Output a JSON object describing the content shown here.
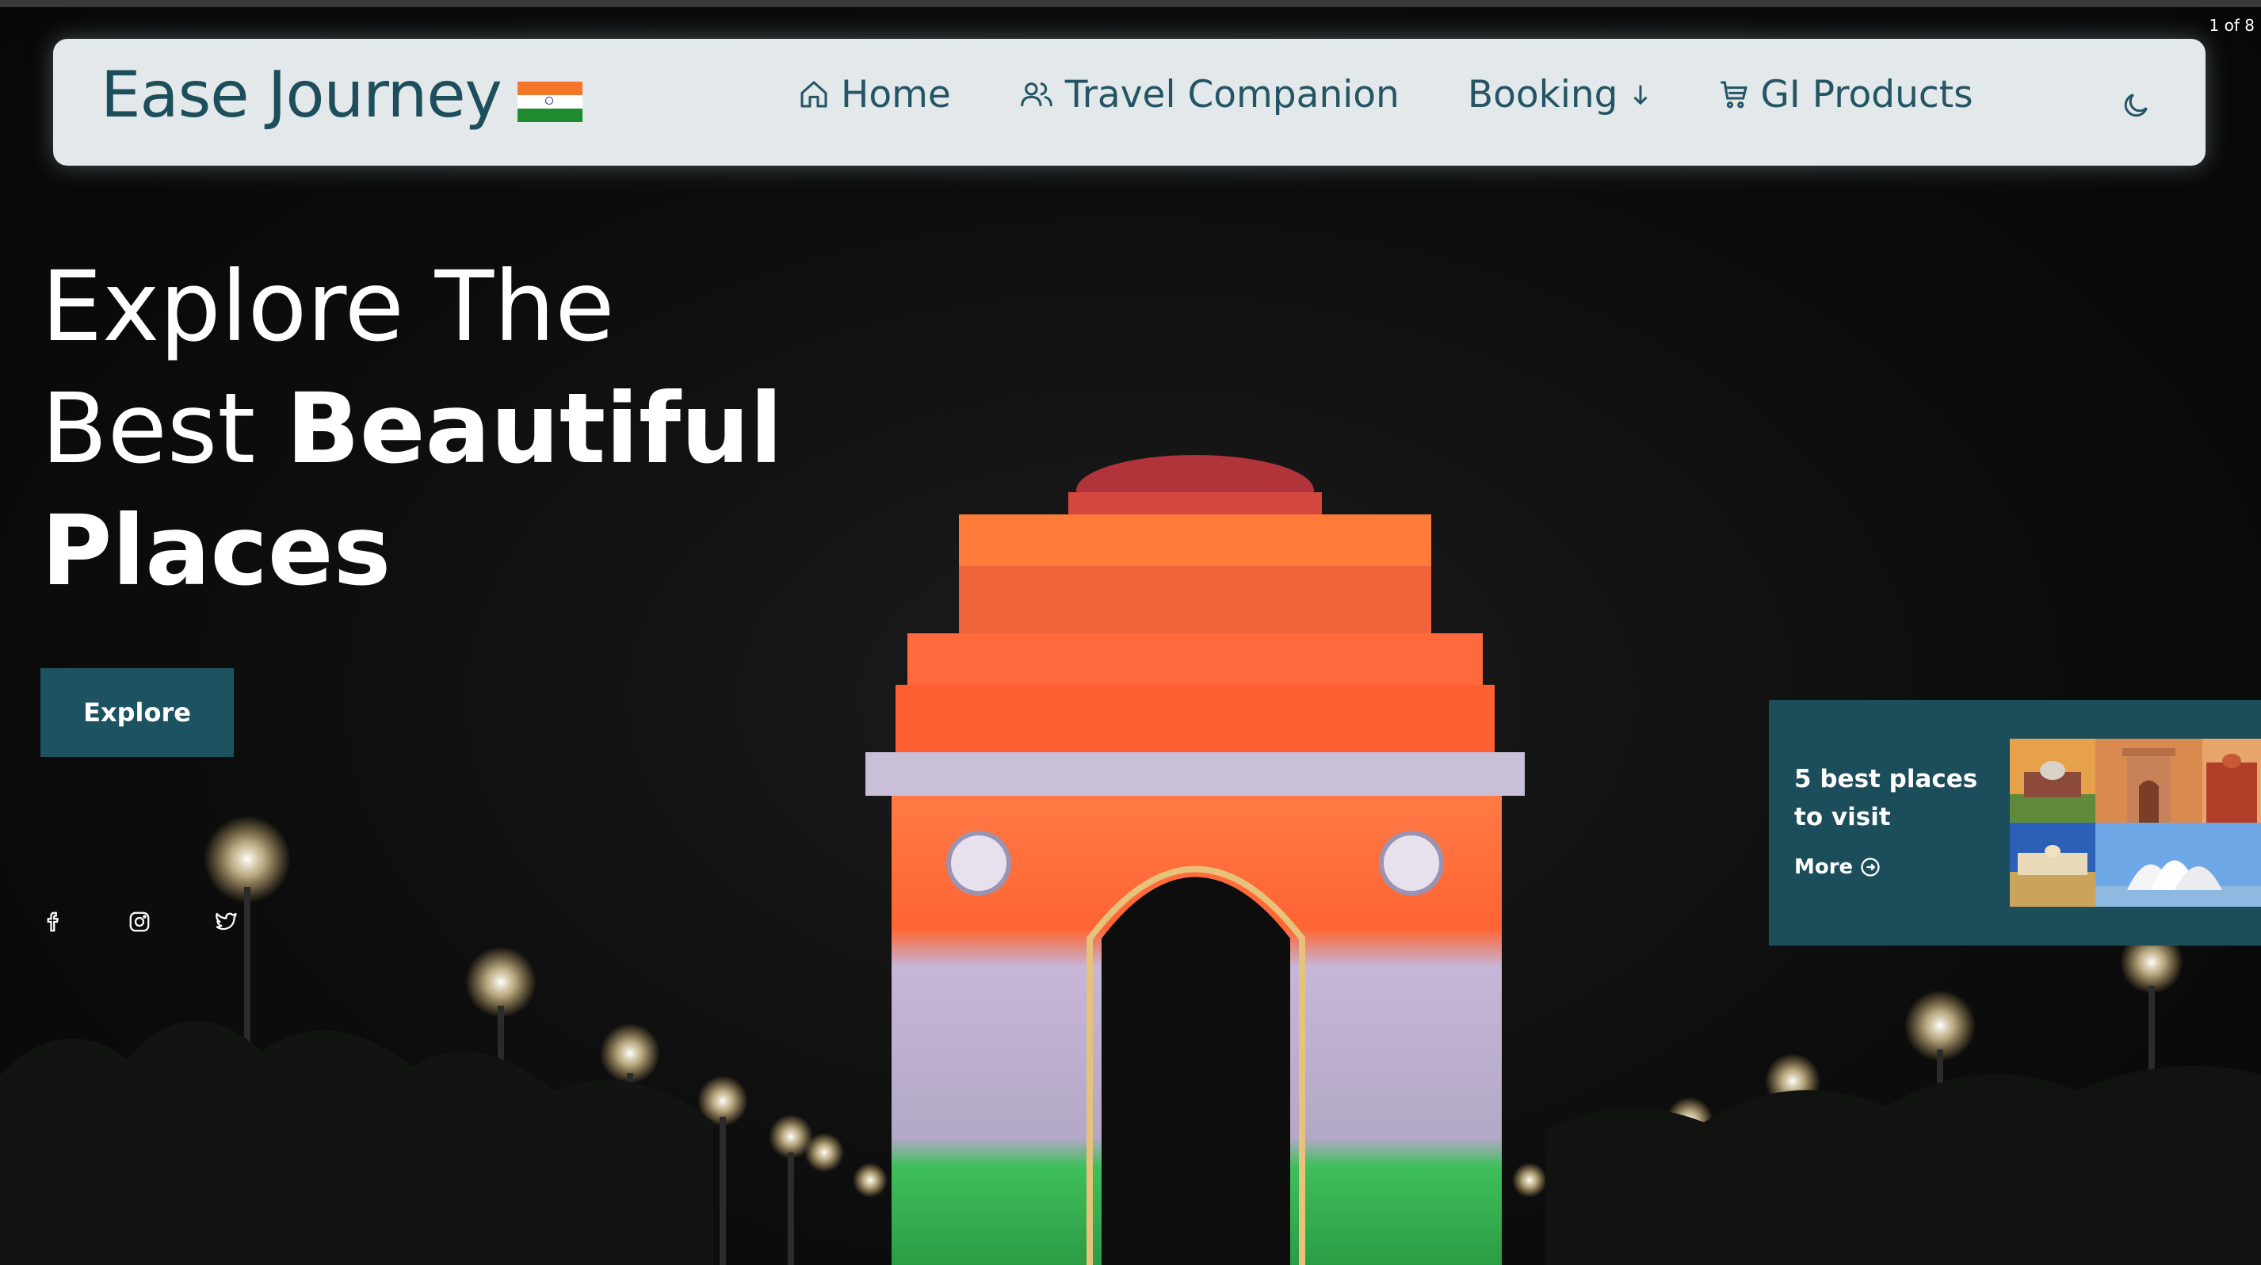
{
  "page_counter": "1 of 8",
  "navbar": {
    "brand": "Ease Journey",
    "items": [
      {
        "label": "Home",
        "icon": "home-icon"
      },
      {
        "label": "Travel Companion",
        "icon": "users-icon"
      },
      {
        "label": "Booking",
        "icon": "arrow-down-icon"
      },
      {
        "label": "GI Products",
        "icon": "cart-icon"
      }
    ],
    "theme_icon": "moon-icon"
  },
  "hero": {
    "line1": "Explore The",
    "line2_regular": "Best ",
    "line2_bold": "Beautiful",
    "line3": "Places",
    "button": "Explore",
    "social": [
      "facebook-icon",
      "instagram-icon",
      "twitter-icon"
    ]
  },
  "card": {
    "title": "5 best places to visit",
    "more": "More"
  },
  "colors": {
    "nav_bg": "#e3e8ea",
    "brand_text": "#1d4e5c",
    "accent": "#1d5260",
    "card_bg": "#1b4d5b"
  }
}
